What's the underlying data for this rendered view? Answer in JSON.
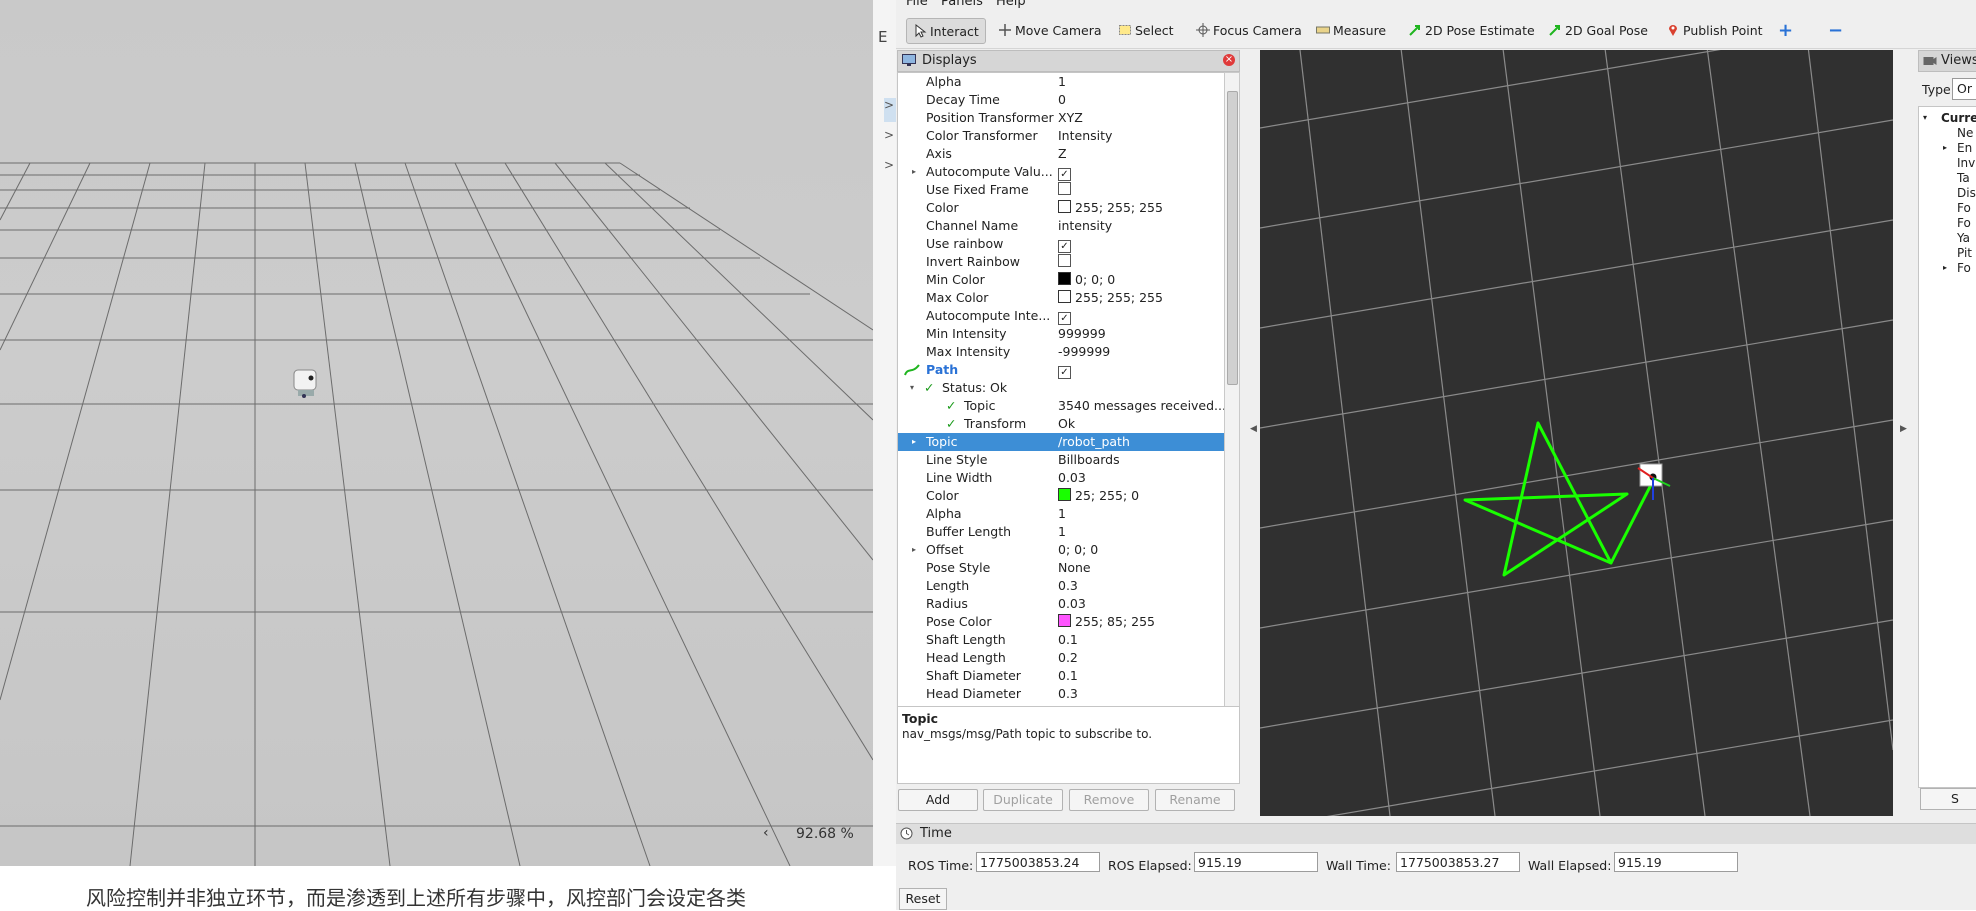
{
  "sim": {
    "zoom": "92.68 %",
    "nav_glyph": "‹",
    "page_text_partial": "风险控制并非独立环节，而是渗透到上述所有步骤中，风控部门会设定各类"
  },
  "strip": {
    "partial_label": "E",
    "arrows": [
      ">",
      ">",
      ">"
    ]
  },
  "menu": {
    "file": "File",
    "panels": "Panels",
    "help": "Help"
  },
  "toolbar": {
    "interact": "Interact",
    "move_camera": "Move Camera",
    "select": "Select",
    "focus_camera": "Focus Camera",
    "measure": "Measure",
    "pose_estimate": "2D Pose Estimate",
    "goal_pose": "2D Goal Pose",
    "publish_point": "Publish Point",
    "add_tool": "+",
    "remove_tool": "−"
  },
  "displays": {
    "title": "Displays",
    "close_glyph": "×",
    "rows": [
      {
        "key": "Alpha",
        "value": "1"
      },
      {
        "key": "Decay Time",
        "value": "0"
      },
      {
        "key": "Position Transformer",
        "value": "XYZ"
      },
      {
        "key": "Color Transformer",
        "value": "Intensity"
      },
      {
        "key": "Axis",
        "value": "Z"
      },
      {
        "key": "Autocompute Valu...",
        "check": "✓",
        "expand": "▸"
      },
      {
        "key": "Use Fixed Frame",
        "check": ""
      },
      {
        "key": "Color",
        "swatch": "#ffffff",
        "value": "255; 255; 255"
      },
      {
        "key": "Channel Name",
        "value": "intensity"
      },
      {
        "key": "Use rainbow",
        "check": "✓"
      },
      {
        "key": "Invert Rainbow",
        "check": ""
      },
      {
        "key": "Min Color",
        "swatch": "#000000",
        "value": "0; 0; 0"
      },
      {
        "key": "Max Color",
        "swatch": "#ffffff",
        "value": "255; 255; 255"
      },
      {
        "key": "Autocompute Inte...",
        "check": "✓"
      },
      {
        "key": "Min Intensity",
        "value": "999999"
      },
      {
        "key": "Max Intensity",
        "value": "-999999"
      }
    ],
    "path": {
      "label": "Path",
      "check": "✓",
      "status": "Status: Ok",
      "status_topic_key": "Topic",
      "status_topic_value": "3540 messages received...",
      "status_transform_key": "Transform",
      "status_transform_value": "Ok",
      "topic_key": "Topic",
      "topic_value": "/robot_path",
      "rows": [
        {
          "key": "Line Style",
          "value": "Billboards"
        },
        {
          "key": "Line Width",
          "value": "0.03"
        },
        {
          "key": "Color",
          "swatch": "#19ff00",
          "value": "25; 255; 0"
        },
        {
          "key": "Alpha",
          "value": "1"
        },
        {
          "key": "Buffer Length",
          "value": "1"
        },
        {
          "key": "Offset",
          "value": "0; 0; 0",
          "expand": "▸"
        },
        {
          "key": "Pose Style",
          "value": "None"
        },
        {
          "key": "Length",
          "value": "0.3"
        },
        {
          "key": "Radius",
          "value": "0.03"
        },
        {
          "key": "Pose Color",
          "swatch": "#ff55ff",
          "value": "255; 85; 255"
        },
        {
          "key": "Shaft Length",
          "value": "0.1"
        },
        {
          "key": "Head Length",
          "value": "0.2"
        },
        {
          "key": "Shaft Diameter",
          "value": "0.1"
        },
        {
          "key": "Head Diameter",
          "value": "0.3"
        }
      ]
    },
    "description_title": "Topic",
    "description_text": "nav_msgs/msg/Path topic to subscribe to.",
    "buttons": {
      "add": "Add",
      "duplicate": "Duplicate",
      "remove": "Remove",
      "rename": "Rename"
    }
  },
  "views": {
    "title": "Views",
    "type_label": "Type:",
    "type_value": "Or",
    "items": [
      "Curre",
      "Ne",
      "En",
      "Inv",
      "Ta",
      "Dis",
      "Fo",
      "Fo",
      "Ya",
      "Pit",
      "Fo"
    ],
    "button_partial": "S"
  },
  "time": {
    "title": "Time",
    "ros_time_label": "ROS Time:",
    "ros_time": "1775003853.24",
    "ros_elapsed_label": "ROS Elapsed:",
    "ros_elapsed": "915.19",
    "wall_time_label": "Wall Time:",
    "wall_time": "1775003853.27",
    "wall_elapsed_label": "Wall Elapsed:",
    "wall_elapsed": "915.19",
    "reset": "Reset"
  },
  "colors": {
    "path_green": "#19ff00",
    "selection_blue": "#3d8ed6",
    "view_bg": "#303030"
  }
}
